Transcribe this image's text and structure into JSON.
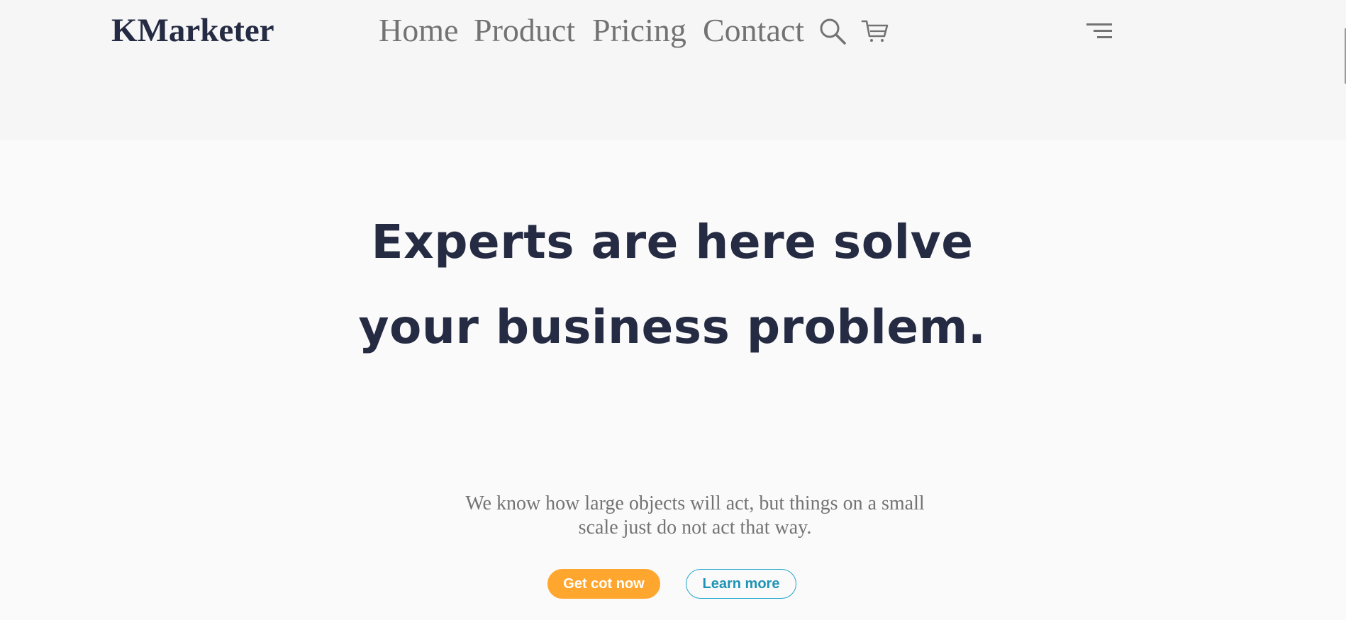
{
  "header": {
    "brand": "KMarketer",
    "nav": [
      {
        "label": "Home"
      },
      {
        "label": "Product"
      },
      {
        "label": "Pricing"
      },
      {
        "label": "Contact"
      }
    ],
    "icons": {
      "search": "search-icon",
      "cart": "cart-icon",
      "menu": "menu-icon"
    }
  },
  "hero": {
    "title": "Experts are here solve your business problem.",
    "subtitle": "We know how large objects will act, but things on a small scale just do not act that way.",
    "primary_button": "Get cot now",
    "secondary_button": "Learn more"
  },
  "colors": {
    "header_bg": "#f6f6f6",
    "page_bg": "#fafafa",
    "heading": "#252b42",
    "muted_text": "#737373",
    "primary_accent": "#ffa62f",
    "secondary_accent": "#23a6cc"
  }
}
